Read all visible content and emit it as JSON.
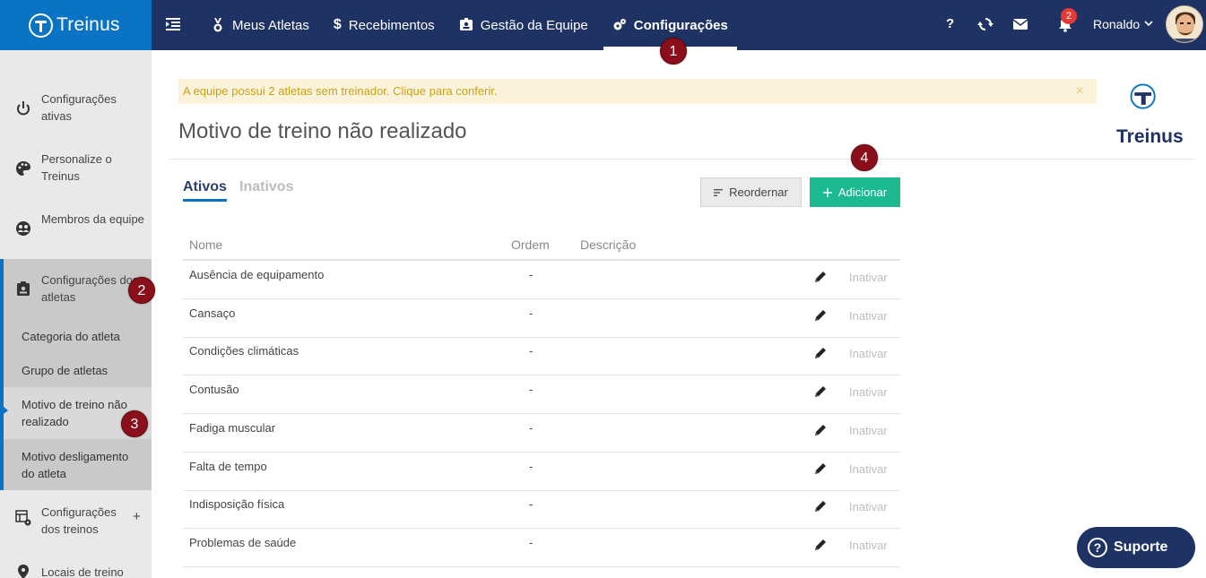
{
  "app": {
    "name": "Treinus"
  },
  "nav": {
    "items": [
      {
        "label": "Meus Atletas",
        "icon": "medal-icon"
      },
      {
        "label": "Recebimentos",
        "icon": "dollar-icon"
      },
      {
        "label": "Gestão da Equipe",
        "icon": "id-card-icon"
      },
      {
        "label": "Configurações",
        "icon": "gears-icon",
        "active": true
      }
    ],
    "help_label": "?",
    "notification_count": "2",
    "user_name": "Ronaldo"
  },
  "steps": [
    "1",
    "2",
    "3",
    "4"
  ],
  "sidebar": {
    "items": [
      {
        "label": "Configurações ativas",
        "icon": "power-icon"
      },
      {
        "label": "Personalize o Treinus",
        "icon": "palette-icon"
      },
      {
        "label": "Membros da equipe",
        "icon": "team-icon"
      },
      {
        "label": "Configurações dos atletas",
        "icon": "badge-icon"
      }
    ],
    "subitems": [
      "Categoria do atleta",
      "Grupo de atletas",
      "Motivo de treino não realizado",
      "Motivo desligamento do atleta"
    ],
    "more_items": [
      {
        "label": "Configurações dos treinos",
        "icon": "grid-gear-icon",
        "expand": "+"
      },
      {
        "label": "Locais de treino",
        "icon": "location-pin-icon"
      }
    ]
  },
  "alert": {
    "text": "A equipe possui 2 atletas sem treinador. Clique para conferir.",
    "close": "×"
  },
  "page": {
    "title": "Motivo de treino não realizado"
  },
  "tabs": {
    "active": "Ativos",
    "inactive": "Inativos"
  },
  "buttons": {
    "reorder": "Reordernar",
    "add": "Adicionar"
  },
  "table": {
    "headers": {
      "name": "Nome",
      "order": "Ordem",
      "description": "Descrição"
    },
    "deactivate_label": "Inativar",
    "rows": [
      {
        "name": "Ausência de equipamento",
        "order": "-"
      },
      {
        "name": "Cansaço",
        "order": "-"
      },
      {
        "name": "Condições climáticas",
        "order": "-"
      },
      {
        "name": "Contusão",
        "order": "-"
      },
      {
        "name": "Fadiga muscular",
        "order": "-"
      },
      {
        "name": "Falta de tempo",
        "order": "-"
      },
      {
        "name": "Indisposição física",
        "order": "-"
      },
      {
        "name": "Problemas de saúde",
        "order": "-"
      }
    ]
  },
  "support": {
    "label": "Suporte",
    "icon": "?"
  },
  "colors": {
    "topbar": "#1e3264",
    "logo_bg": "#0a73c3",
    "accent_green": "#1db991",
    "alert_bg": "#fcf4da",
    "alert_text": "#c9a016",
    "step_marker": "#8b0f1a"
  }
}
